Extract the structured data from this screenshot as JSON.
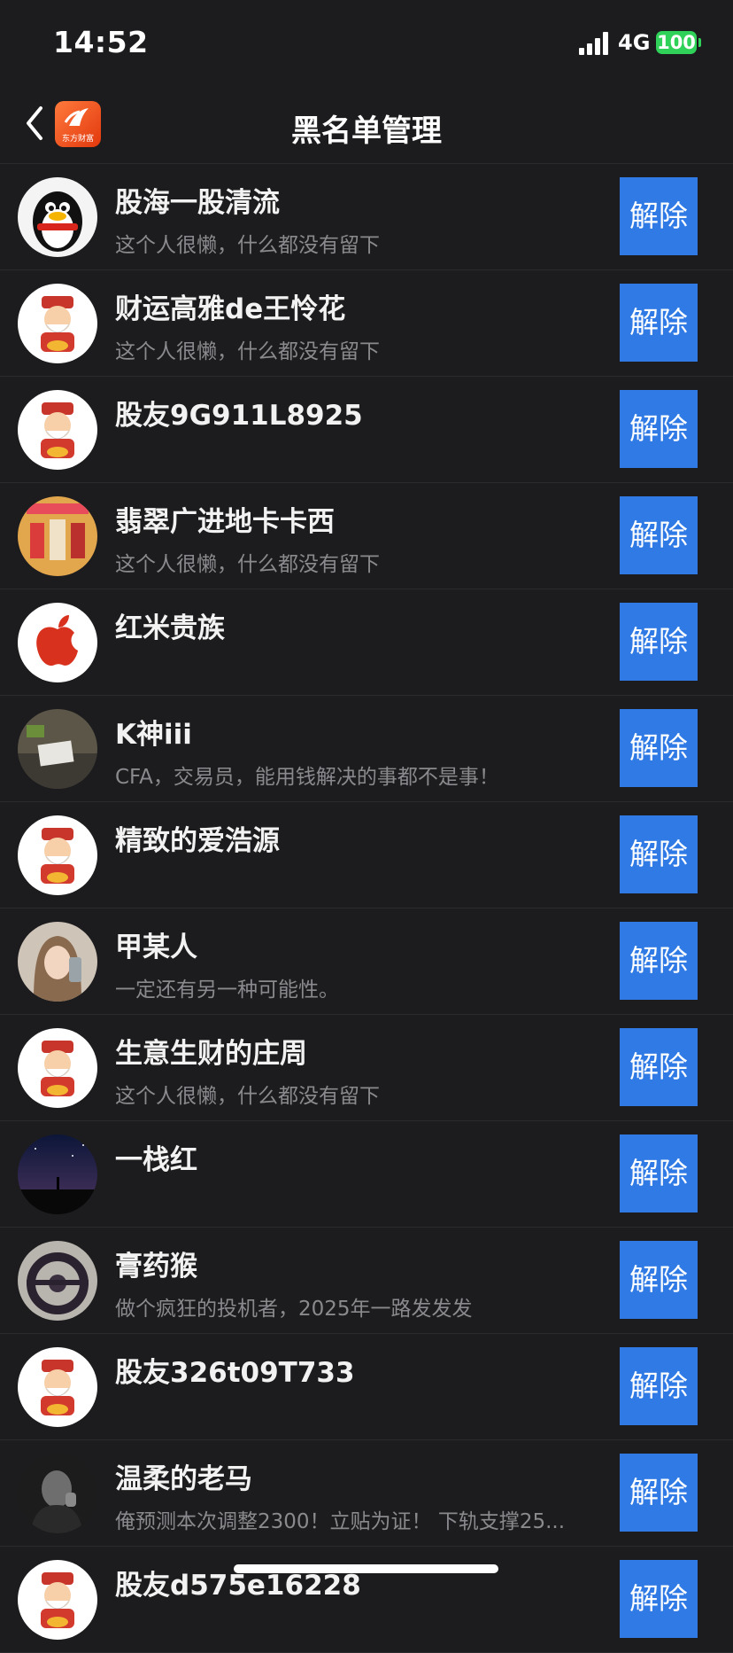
{
  "status": {
    "time": "14:52",
    "network": "4G",
    "battery": "100"
  },
  "nav": {
    "title": "黑名单管理",
    "logo_text": "东方财富"
  },
  "unblock_label": "解除",
  "rows": [
    {
      "name": "股海一股清流",
      "bio": "这个人很懒，什么都没有留下",
      "avatar": "penguin-avatar"
    },
    {
      "name": "财运高雅de王怜花",
      "bio": "这个人很懒，什么都没有留下",
      "avatar": "fortune-god-avatar"
    },
    {
      "name": "股友9G911L8925",
      "bio": "",
      "avatar": "fortune-god-avatar"
    },
    {
      "name": "翡翠广进地卡卡西",
      "bio": "这个人很懒，什么都没有留下",
      "avatar": "family-photo-avatar"
    },
    {
      "name": "红米贵族",
      "bio": "",
      "avatar": "apple-logo-avatar"
    },
    {
      "name": "K神iii",
      "bio": "CFA，交易员，能用钱解决的事都不是事！",
      "avatar": "desk-photo-avatar"
    },
    {
      "name": "精致的爱浩源",
      "bio": "",
      "avatar": "fortune-god-avatar"
    },
    {
      "name": "甲某人",
      "bio": "一定还有另一种可能性。",
      "avatar": "portrait-avatar"
    },
    {
      "name": "生意生财的庄周",
      "bio": "这个人很懒，什么都没有留下",
      "avatar": "fortune-god-avatar"
    },
    {
      "name": "一栈红",
      "bio": "",
      "avatar": "night-sky-avatar"
    },
    {
      "name": "膏药猴",
      "bio": "做个疯狂的投机者，2025年一路发发发",
      "avatar": "steering-wheel-avatar"
    },
    {
      "name": "股友326t09T733",
      "bio": "",
      "avatar": "fortune-god-avatar"
    },
    {
      "name": "温柔的老马",
      "bio": "俺预测本次调整2300！立贴为证！ 下轨支撑25...",
      "avatar": "man-portrait-avatar"
    },
    {
      "name": "股友d575e16228",
      "bio": "",
      "avatar": "fortune-god-avatar"
    }
  ]
}
